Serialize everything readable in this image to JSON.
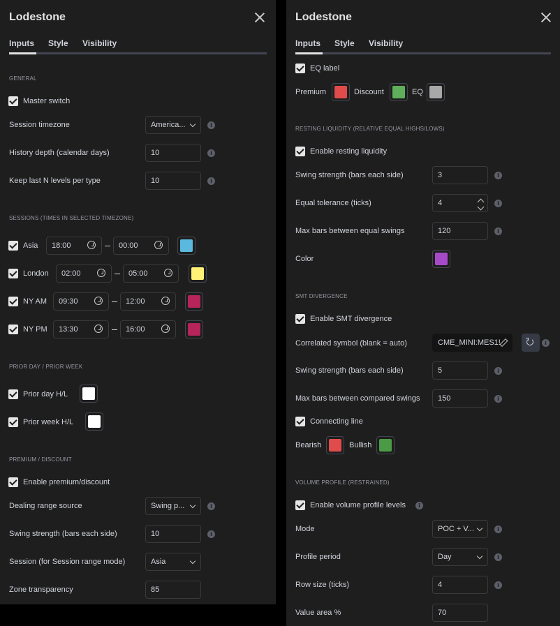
{
  "left": {
    "title": "Lodestone",
    "tabs": [
      "Inputs",
      "Style",
      "Visibility"
    ],
    "general": {
      "header": "General",
      "master_switch": "Master switch",
      "session_timezone": {
        "label": "Session timezone",
        "value": "America..."
      },
      "history_depth": {
        "label": "History depth (calendar days)",
        "value": "10"
      },
      "keep_last": {
        "label": "Keep last N levels per type",
        "value": "10"
      }
    },
    "sessions": {
      "header": "Sessions (times in selected timezone)",
      "rows": [
        {
          "label": "Asia",
          "start": "18:00",
          "end": "00:00",
          "color": "#5bb8de"
        },
        {
          "label": "London",
          "start": "02:00",
          "end": "05:00",
          "color": "#fff176"
        },
        {
          "label": "NY AM",
          "start": "09:30",
          "end": "12:00",
          "color": "#b5255a"
        },
        {
          "label": "NY PM",
          "start": "13:30",
          "end": "16:00",
          "color": "#b5255a"
        }
      ]
    },
    "prior": {
      "header": "Prior day / Prior week",
      "day": {
        "label": "Prior day H/L",
        "color": "#ffffff"
      },
      "week": {
        "label": "Prior week H/L",
        "color": "#ffffff"
      }
    },
    "premium": {
      "header": "Premium / Discount",
      "enable": "Enable premium/discount",
      "range_source": {
        "label": "Dealing range source",
        "value": "Swing p..."
      },
      "swing_strength": {
        "label": "Swing strength (bars each side)",
        "value": "10"
      },
      "session": {
        "label": "Session (for Session range mode)",
        "value": "Asia"
      },
      "zone_transparency": {
        "label": "Zone transparency",
        "value": "85"
      }
    }
  },
  "right": {
    "title": "Lodestone",
    "tabs": [
      "Inputs",
      "Style",
      "Visibility"
    ],
    "eq": {
      "label": "EQ label",
      "premium": {
        "label": "Premium",
        "color": "#e04b4b"
      },
      "discount": {
        "label": "Discount",
        "color": "#5fae5a"
      },
      "eqcolor": {
        "label": "EQ",
        "color": "#a8a8a8"
      }
    },
    "resting": {
      "header": "Resting liquidity (relative equal highs/lows)",
      "enable": "Enable resting liquidity",
      "swing_strength": {
        "label": "Swing strength (bars each side)",
        "value": "3"
      },
      "equal_tolerance": {
        "label": "Equal tolerance (ticks)",
        "value": "4"
      },
      "max_bars": {
        "label": "Max bars between equal swings",
        "value": "120"
      },
      "color": {
        "label": "Color",
        "color": "#a64ac9"
      }
    },
    "smt": {
      "header": "SMT divergence",
      "enable": "Enable SMT divergence",
      "correlated": {
        "label": "Correlated symbol (blank = auto)",
        "value": "CME_MINI:MES1!"
      },
      "swing_strength": {
        "label": "Swing strength (bars each side)",
        "value": "5"
      },
      "max_bars": {
        "label": "Max bars between compared swings",
        "value": "150"
      },
      "connecting": "Connecting line",
      "bearish": {
        "label": "Bearish",
        "color": "#e04b4b"
      },
      "bullish": {
        "label": "Bullish",
        "color": "#4b9a45"
      }
    },
    "volume": {
      "header": "Volume profile (restrained)",
      "enable": "Enable volume profile levels",
      "mode": {
        "label": "Mode",
        "value": "POC + V..."
      },
      "profile_period": {
        "label": "Profile period",
        "value": "Day"
      },
      "row_size": {
        "label": "Row size (ticks)",
        "value": "4"
      },
      "value_area": {
        "label": "Value area %",
        "value": "70"
      }
    }
  },
  "icons": {
    "close": "close-icon",
    "info": "info-icon",
    "clock": "clock-icon",
    "chevron": "chevron-down-icon",
    "reset": "reset-icon",
    "pencil": "pencil-icon",
    "checkbox": "checkmark-icon"
  }
}
